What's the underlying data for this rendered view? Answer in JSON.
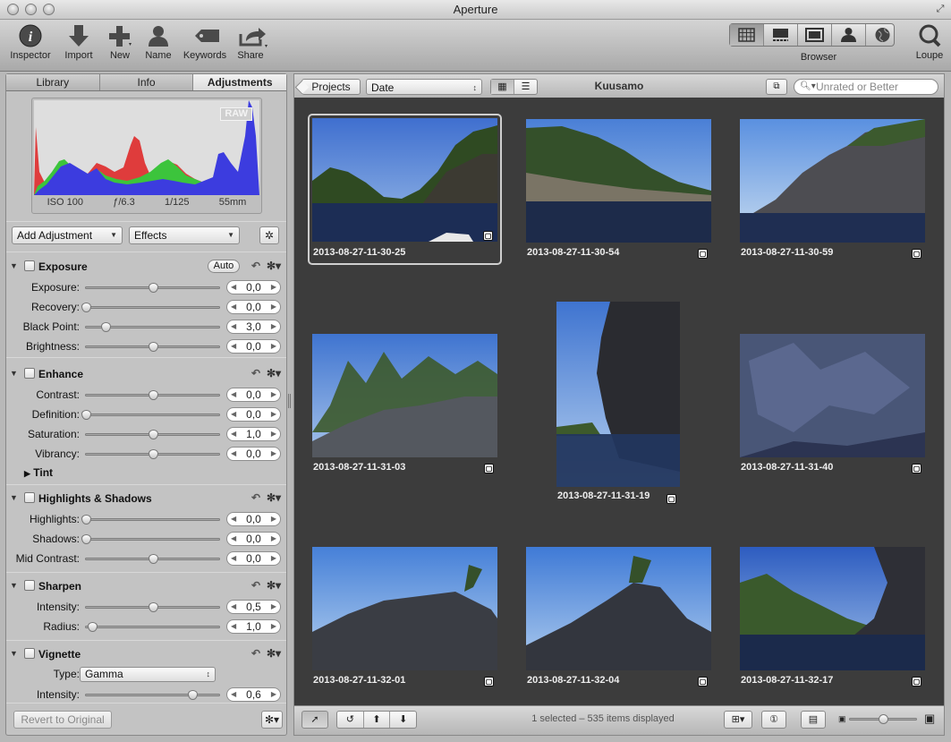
{
  "window": {
    "title": "Aperture"
  },
  "toolbar": {
    "inspector": "Inspector",
    "import": "Import",
    "new": "New",
    "name": "Name",
    "keywords": "Keywords",
    "share": "Share",
    "browser": "Browser",
    "loupe": "Loupe"
  },
  "inspector": {
    "tabs": [
      "Library",
      "Info",
      "Adjustments"
    ],
    "raw_badge": "RAW",
    "histogram_meta": {
      "iso": "ISO 100",
      "aperture": "ƒ/6.3",
      "shutter": "1/125",
      "focal": "55mm"
    },
    "add_adjustment": "Add Adjustment",
    "effects": "Effects",
    "exposure": {
      "title": "Exposure",
      "auto": "Auto",
      "rows": [
        {
          "label": "Exposure:",
          "value": "0,0",
          "pos": 0.5
        },
        {
          "label": "Recovery:",
          "value": "0,0",
          "pos": 0.0
        },
        {
          "label": "Black Point:",
          "value": "3,0",
          "pos": 0.15
        },
        {
          "label": "Brightness:",
          "value": "0,0",
          "pos": 0.5
        }
      ]
    },
    "enhance": {
      "title": "Enhance",
      "rows": [
        {
          "label": "Contrast:",
          "value": "0,0",
          "pos": 0.5
        },
        {
          "label": "Definition:",
          "value": "0,0",
          "pos": 0.0
        },
        {
          "label": "Saturation:",
          "value": "1,0",
          "pos": 0.5
        },
        {
          "label": "Vibrancy:",
          "value": "0,0",
          "pos": 0.5
        }
      ],
      "tint": "Tint"
    },
    "highlights_shadows": {
      "title": "Highlights & Shadows",
      "rows": [
        {
          "label": "Highlights:",
          "value": "0,0",
          "pos": 0.0
        },
        {
          "label": "Shadows:",
          "value": "0,0",
          "pos": 0.0
        },
        {
          "label": "Mid Contrast:",
          "value": "0,0",
          "pos": 0.5
        }
      ]
    },
    "sharpen": {
      "title": "Sharpen",
      "rows": [
        {
          "label": "Intensity:",
          "value": "0,5",
          "pos": 0.5
        },
        {
          "label": "Radius:",
          "value": "1,0",
          "pos": 0.05
        }
      ]
    },
    "vignette": {
      "title": "Vignette",
      "type_label": "Type:",
      "type_value": "Gamma",
      "rows": [
        {
          "label": "Intensity:",
          "value": "0,6",
          "pos": 0.8
        }
      ]
    },
    "revert": "Revert to Original"
  },
  "browser_bar": {
    "projects": "Projects",
    "sort": "Date",
    "project_title": "Kuusamo",
    "search_placeholder": "Unrated or Better"
  },
  "photos": [
    "2013-08-27-11-30-25",
    "2013-08-27-11-30-54",
    "2013-08-27-11-30-59",
    "2013-08-27-11-31-03",
    "2013-08-27-11-31-19",
    "2013-08-27-11-31-40",
    "2013-08-27-11-32-01",
    "2013-08-27-11-32-04",
    "2013-08-27-11-32-17"
  ],
  "status": "1 selected – 535 items displayed"
}
